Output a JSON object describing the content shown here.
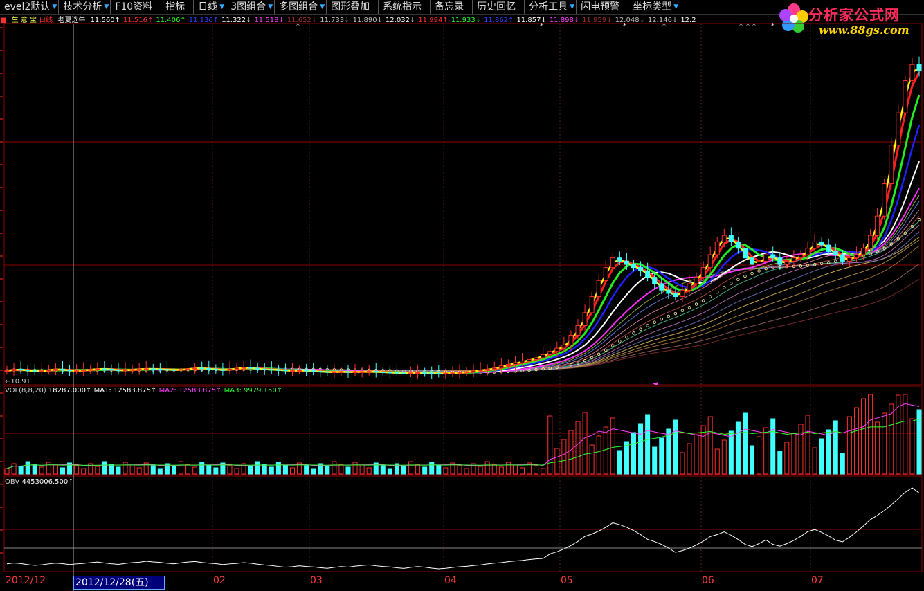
{
  "toolbar": {
    "items": [
      {
        "label": "evel2默认",
        "dropdown": true
      },
      {
        "label": "技术分析",
        "dropdown": true
      },
      {
        "label": "F10资料",
        "dropdown": false
      },
      {
        "label": "指标",
        "dropdown": false
      },
      {
        "label": "日线",
        "dropdown": true
      },
      {
        "label": "3图组合",
        "dropdown": true
      },
      {
        "label": "多图组合",
        "dropdown": true
      },
      {
        "label": "图形叠加",
        "dropdown": false
      },
      {
        "label": "系统指示",
        "dropdown": false
      },
      {
        "label": "备忘录",
        "dropdown": false
      },
      {
        "label": "历史回忆",
        "dropdown": false
      },
      {
        "label": "分析工具",
        "dropdown": true
      },
      {
        "label": "闪电预警",
        "dropdown": false
      },
      {
        "label": "坐标类型",
        "dropdown": true
      }
    ]
  },
  "logo": {
    "title": "分析家公式网",
    "url": "www.88gs.com"
  },
  "info_row": {
    "prefix": "生 意 宝",
    "period": "日线",
    "formula": "老夏选牛",
    "values": [
      {
        "text": "11.560↑",
        "color": "#ffffff"
      },
      {
        "text": "11.516↑",
        "color": "#ff3030"
      },
      {
        "text": "11.406↑",
        "color": "#30ff30"
      },
      {
        "text": "11.136↑",
        "color": "#3040ff"
      },
      {
        "text": "11.322↓",
        "color": "#ffffff"
      },
      {
        "text": "11.518↓",
        "color": "#ff40ff"
      },
      {
        "text": "11.652↓",
        "color": "#a03030"
      },
      {
        "text": "11.733↓",
        "color": "#c0c0c0"
      },
      {
        "text": "11.890↓",
        "color": "#c0c0c0"
      },
      {
        "text": "12.032↓",
        "color": "#ffffff"
      },
      {
        "text": "11.994↑",
        "color": "#ff3030"
      },
      {
        "text": "11.933↓",
        "color": "#30ff30"
      },
      {
        "text": "11.862↑",
        "color": "#3040ff"
      },
      {
        "text": "11.857↓",
        "color": "#ffffff"
      },
      {
        "text": "11.898↓",
        "color": "#ff40ff"
      },
      {
        "text": "11.959↓",
        "color": "#a03030"
      },
      {
        "text": "12.048↓",
        "color": "#c0c0c0"
      },
      {
        "text": "12.146↓",
        "color": "#c0c0c0"
      },
      {
        "text": "12.2",
        "color": "#ffffff"
      }
    ]
  },
  "price_panel": {
    "low_label": "←10.91"
  },
  "vol_panel": {
    "name": "VOL(8,8,20)",
    "v1": "18287.000↑",
    "ma1": "MA1: 12583.875↑",
    "ma2": "MA2: 12583.875↑",
    "ma3": "MA3: 9979.150↑"
  },
  "obv_panel": {
    "name": "OBV",
    "value": "4453006.500↑"
  },
  "date_axis": {
    "labels": [
      "2012/12",
      "02",
      "03",
      "04",
      "05",
      "06",
      "07"
    ],
    "cursor_date": "2012/12/28(五)"
  },
  "colors": {
    "ma_yellow": "#ffff00",
    "ma_red": "#ff2020",
    "ma_green": "#22ee22",
    "ma_blue": "#2020ff",
    "ma_white": "#ffffff",
    "ma_magenta": "#ff30ff",
    "up": "#ff3030",
    "down": "#40ffff",
    "grid": "#8b0000"
  },
  "chart_data": {
    "type": "line",
    "close": [
      11.0,
      11.05,
      11.02,
      11.0,
      10.98,
      11.0,
      11.03,
      11.05,
      11.02,
      11.0,
      11.0,
      11.02,
      11.04,
      11.06,
      11.05,
      11.03,
      11.0,
      11.02,
      11.04,
      11.05,
      11.06,
      11.05,
      11.04,
      11.03,
      11.02,
      11.04,
      11.06,
      11.08,
      11.07,
      11.05,
      11.03,
      11.02,
      11.05,
      11.08,
      11.1,
      11.08,
      11.05,
      11.04,
      11.03,
      11.02,
      11.0,
      11.0,
      11.01,
      11.0,
      10.98,
      10.97,
      10.95,
      10.96,
      10.97,
      10.95,
      10.96,
      10.97,
      10.98,
      10.96,
      10.95,
      10.94,
      10.93,
      10.92,
      10.93,
      10.94,
      10.93,
      10.92,
      10.91,
      10.92,
      10.93,
      10.95,
      10.97,
      11.0,
      11.02,
      11.05,
      11.08,
      11.15,
      11.2,
      11.25,
      11.3,
      11.35,
      11.4,
      11.5,
      11.6,
      11.7,
      11.8,
      12.1,
      12.4,
      12.8,
      13.3,
      13.8,
      14.2,
      14.5,
      14.4,
      14.3,
      14.2,
      14.1,
      13.9,
      13.7,
      13.5,
      13.4,
      13.3,
      13.5,
      13.7,
      13.9,
      14.2,
      14.6,
      15.0,
      15.2,
      15.0,
      14.8,
      14.5,
      14.3,
      14.4,
      14.6,
      14.5,
      14.3,
      14.4,
      14.5,
      14.6,
      14.8,
      15.0,
      14.9,
      14.7,
      14.6,
      14.4,
      14.5,
      14.6,
      14.8,
      15.2,
      15.8,
      16.8,
      18.0,
      19.0,
      20.0,
      20.5,
      20.3
    ]
  }
}
